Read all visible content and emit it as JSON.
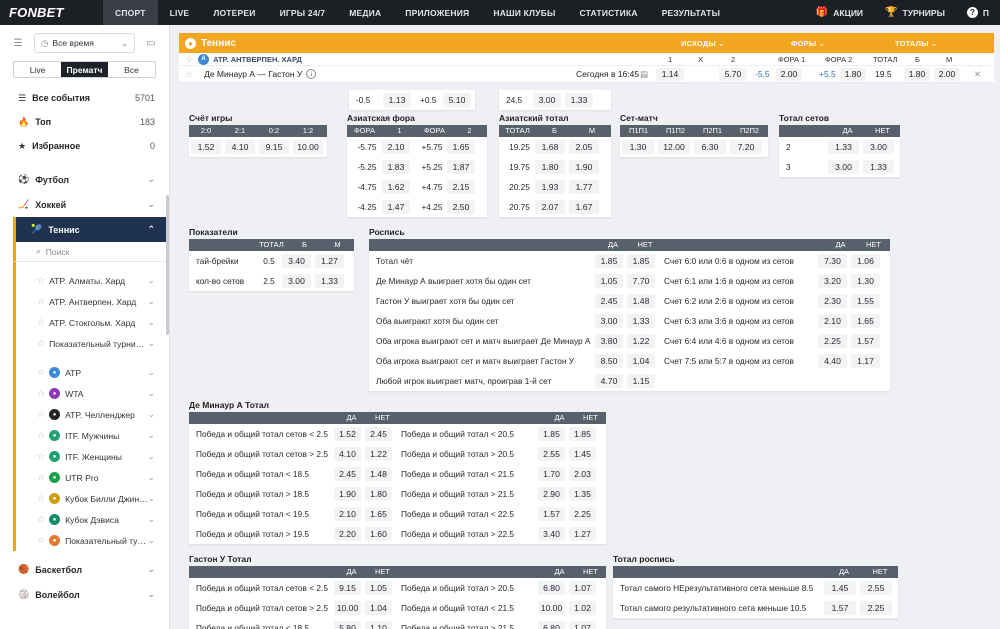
{
  "header": {
    "logo": "FONBET",
    "nav": [
      "СПОРТ",
      "LIVE",
      "ЛОТЕРЕИ",
      "ИГРЫ 24/7",
      "МЕДИА",
      "ПРИЛОЖЕНИЯ",
      "НАШИ КЛУБЫ",
      "СТАТИСТИКА",
      "РЕЗУЛЬТАТЫ"
    ],
    "promo": "АКЦИИ",
    "tournaments": "ТУРНИРЫ",
    "help": "П"
  },
  "sidebar": {
    "period": "Все время",
    "tabs": [
      "Live",
      "Прематч",
      "Все"
    ],
    "items": [
      {
        "label": "Все события",
        "count": "5701"
      },
      {
        "label": "Топ",
        "count": "183"
      },
      {
        "label": "Избранное",
        "count": "0"
      }
    ],
    "sports": [
      {
        "label": "Футбол"
      },
      {
        "label": "Хоккей"
      },
      {
        "label": "Теннис"
      }
    ],
    "search": "Поиск",
    "fav_tournaments": [
      "ATP. Алматы. Хард",
      "ATP. Антверпен. Хард",
      "ATP. Стокгольм. Хард",
      "Показательный турнир. ..."
    ],
    "tours": [
      {
        "label": "ATP",
        "color": "#3a8ad8"
      },
      {
        "label": "WTA",
        "color": "#8a3ab8"
      },
      {
        "label": "ATP. Челленджер",
        "color": "#222222"
      },
      {
        "label": "ITF. Мужчины",
        "color": "#22a070"
      },
      {
        "label": "ITF. Женщины",
        "color": "#22a070"
      },
      {
        "label": "UTR Pro",
        "color": "#1aa048"
      },
      {
        "label": "Кубок Билли Джин К...",
        "color": "#caa010"
      },
      {
        "label": "Кубок Дэвиса",
        "color": "#168a6a"
      },
      {
        "label": "Показательный тур...",
        "color": "#e07a30"
      }
    ],
    "more_sports": [
      {
        "label": "Баскетбол"
      },
      {
        "label": "Волейбол"
      }
    ]
  },
  "tennis_bar": {
    "title": "Теннис",
    "outcomes": "ИСХОДЫ",
    "handicaps": "ФОРЫ",
    "totals": "ТОТАЛЫ"
  },
  "tournament_row": {
    "name": "ATP. АНТВЕРПЕН. ХАРД",
    "cols": [
      "1",
      "X",
      "2",
      "ФОРА 1",
      "ФОРА 2",
      "ТОТАЛ",
      "Б",
      "М"
    ]
  },
  "match": {
    "name": "Де Минаур А — Гастон У",
    "time": "Сегодня в 16:45",
    "odds": [
      "1.14",
      "5.70",
      "-5.5",
      "2.00",
      "+5.5",
      "1.80",
      "19.5",
      "1.80",
      "2.00"
    ]
  },
  "top_partial": [
    [
      "-0.5",
      "1.13",
      "+0.5",
      "5.10"
    ],
    [
      "24.5",
      "3.00",
      "1.33"
    ]
  ],
  "set_score": {
    "title": "Счёт игры",
    "headers": [
      "2:0",
      "2:1",
      "0:2",
      "1:2"
    ],
    "values": [
      "1.52",
      "4.10",
      "9.15",
      "10.00"
    ]
  },
  "asian_handicap": {
    "title": "Азиатская фора",
    "headers": [
      "ФОРА",
      "1",
      "ФОРА",
      "2"
    ],
    "rows": [
      [
        "-5.75",
        "2.10",
        "+5.75",
        "1.65"
      ],
      [
        "-5.25",
        "1.83",
        "+5.25",
        "1.87"
      ],
      [
        "-4.75",
        "1.62",
        "+4.75",
        "2.15"
      ],
      [
        "-4.25",
        "1.47",
        "+4.25",
        "2.50"
      ]
    ]
  },
  "asian_total": {
    "title": "Азиатский тотал",
    "headers": [
      "ТОТАЛ",
      "Б",
      "М"
    ],
    "rows": [
      [
        "19.25",
        "1.68",
        "2.05"
      ],
      [
        "19.75",
        "1.80",
        "1.90"
      ],
      [
        "20.25",
        "1.93",
        "1.77"
      ],
      [
        "20.75",
        "2.07",
        "1.67"
      ]
    ]
  },
  "set_match": {
    "title": "Сет-матч",
    "headers": [
      "П1П1",
      "П1П2",
      "П2П1",
      "П2П2"
    ],
    "values": [
      "1.30",
      "12.00",
      "6.30",
      "7.20"
    ]
  },
  "total_sets": {
    "title": "Тотал сетов",
    "headers": [
      "",
      "ДА",
      "НЕТ"
    ],
    "rows": [
      [
        "2",
        "1.33",
        "3.00"
      ],
      [
        "3",
        "3.00",
        "1.33"
      ]
    ]
  },
  "indicators": {
    "title": "Показатели",
    "headers": [
      "",
      "ТОТАЛ",
      "Б",
      "М"
    ],
    "rows": [
      [
        "тай-брейки",
        "0.5",
        "3.40",
        "1.27"
      ],
      [
        "кол-во сетов",
        "2.5",
        "3.00",
        "1.33"
      ]
    ]
  },
  "schedule": {
    "title": "Роспись",
    "headers": [
      "",
      "ДА",
      "НЕТ",
      "",
      "ДА",
      "НЕТ"
    ],
    "left": [
      [
        "Тотал чёт",
        "1.85",
        "1.85"
      ],
      [
        "Де Минаур А выиграет хотя бы один сет",
        "1.05",
        "7.70"
      ],
      [
        "Гастон У выиграет хотя бы один сет",
        "2.45",
        "1.48"
      ],
      [
        "Оба выиграют хотя бы один сет",
        "3.00",
        "1.33"
      ],
      [
        "Оба игрока выиграют сет и матч выиграет Де Минаур А",
        "3.80",
        "1.22"
      ],
      [
        "Оба игрока выиграют сет и матч выиграет Гастон У",
        "8.50",
        "1.04"
      ],
      [
        "Любой игрок выиграет матч, проиграв 1-й сет",
        "4.70",
        "1.15"
      ]
    ],
    "right": [
      [
        "Счет 6:0 или 0:6 в одном из сетов",
        "7.30",
        "1.06"
      ],
      [
        "Счет 6:1 или 1:6 в одном из сетов",
        "3.20",
        "1.30"
      ],
      [
        "Счет 6:2 или 2:6 в одном из сетов",
        "2.30",
        "1.55"
      ],
      [
        "Счет 6:3 или 3:6 в одном из сетов",
        "2.10",
        "1.65"
      ],
      [
        "Счет 6:4 или 4:6 в одном из сетов",
        "2.25",
        "1.57"
      ],
      [
        "Счет 7:5 или 5:7 в одном из сетов",
        "4.40",
        "1.17"
      ]
    ]
  },
  "deminaur_total": {
    "title": "Де Минаур А Тотал",
    "headers": [
      "",
      "ДА",
      "НЕТ",
      "",
      "ДА",
      "НЕТ"
    ],
    "left": [
      [
        "Победа и общий тотал сетов < 2.5",
        "1.52",
        "2.45"
      ],
      [
        "Победа и общий тотал сетов > 2.5",
        "4.10",
        "1.22"
      ],
      [
        "Победа и общий тотал < 18.5",
        "2.45",
        "1.48"
      ],
      [
        "Победа и общий тотал > 18.5",
        "1.90",
        "1.80"
      ],
      [
        "Победа и общий тотал < 19.5",
        "2.10",
        "1.65"
      ],
      [
        "Победа и общий тотал > 19.5",
        "2.20",
        "1.60"
      ]
    ],
    "right": [
      [
        "Победа и общий тотал < 20.5",
        "1.85",
        "1.85"
      ],
      [
        "Победа и общий тотал > 20.5",
        "2.55",
        "1.45"
      ],
      [
        "Победа и общий тотал < 21.5",
        "1.70",
        "2.03"
      ],
      [
        "Победа и общий тотал > 21.5",
        "2.90",
        "1.35"
      ],
      [
        "Победа и общий тотал < 22.5",
        "1.57",
        "2.25"
      ],
      [
        "Победа и общий тотал > 22.5",
        "3.40",
        "1.27"
      ]
    ]
  },
  "gaston_total": {
    "title": "Гастон У Тотал",
    "headers": [
      "",
      "ДА",
      "НЕТ",
      "",
      "ДА",
      "НЕТ"
    ],
    "left": [
      [
        "Победа и общий тотал сетов < 2.5",
        "9.15",
        "1.05"
      ],
      [
        "Победа и общий тотал сетов > 2.5",
        "10.00",
        "1.04"
      ],
      [
        "Победа и общий тотал < 18.5",
        "5.80",
        "1.10"
      ]
    ],
    "right": [
      [
        "Победа и общий тотал > 20.5",
        "6.80",
        "1.07"
      ],
      [
        "Победа и общий тотал < 21.5",
        "10.00",
        "1.02"
      ],
      [
        "Победа и общий тотал > 21.5",
        "6.80",
        "1.07"
      ]
    ]
  },
  "total_schedule": {
    "title": "Тотал роспись",
    "headers": [
      "",
      "ДА",
      "НЕТ"
    ],
    "rows": [
      [
        "Тотал самого НЕрезультативного сета меньше 8.5",
        "1.45",
        "2.55"
      ],
      [
        "Тотал самого результативного сета меньше 10.5",
        "1.57",
        "2.25"
      ]
    ]
  }
}
